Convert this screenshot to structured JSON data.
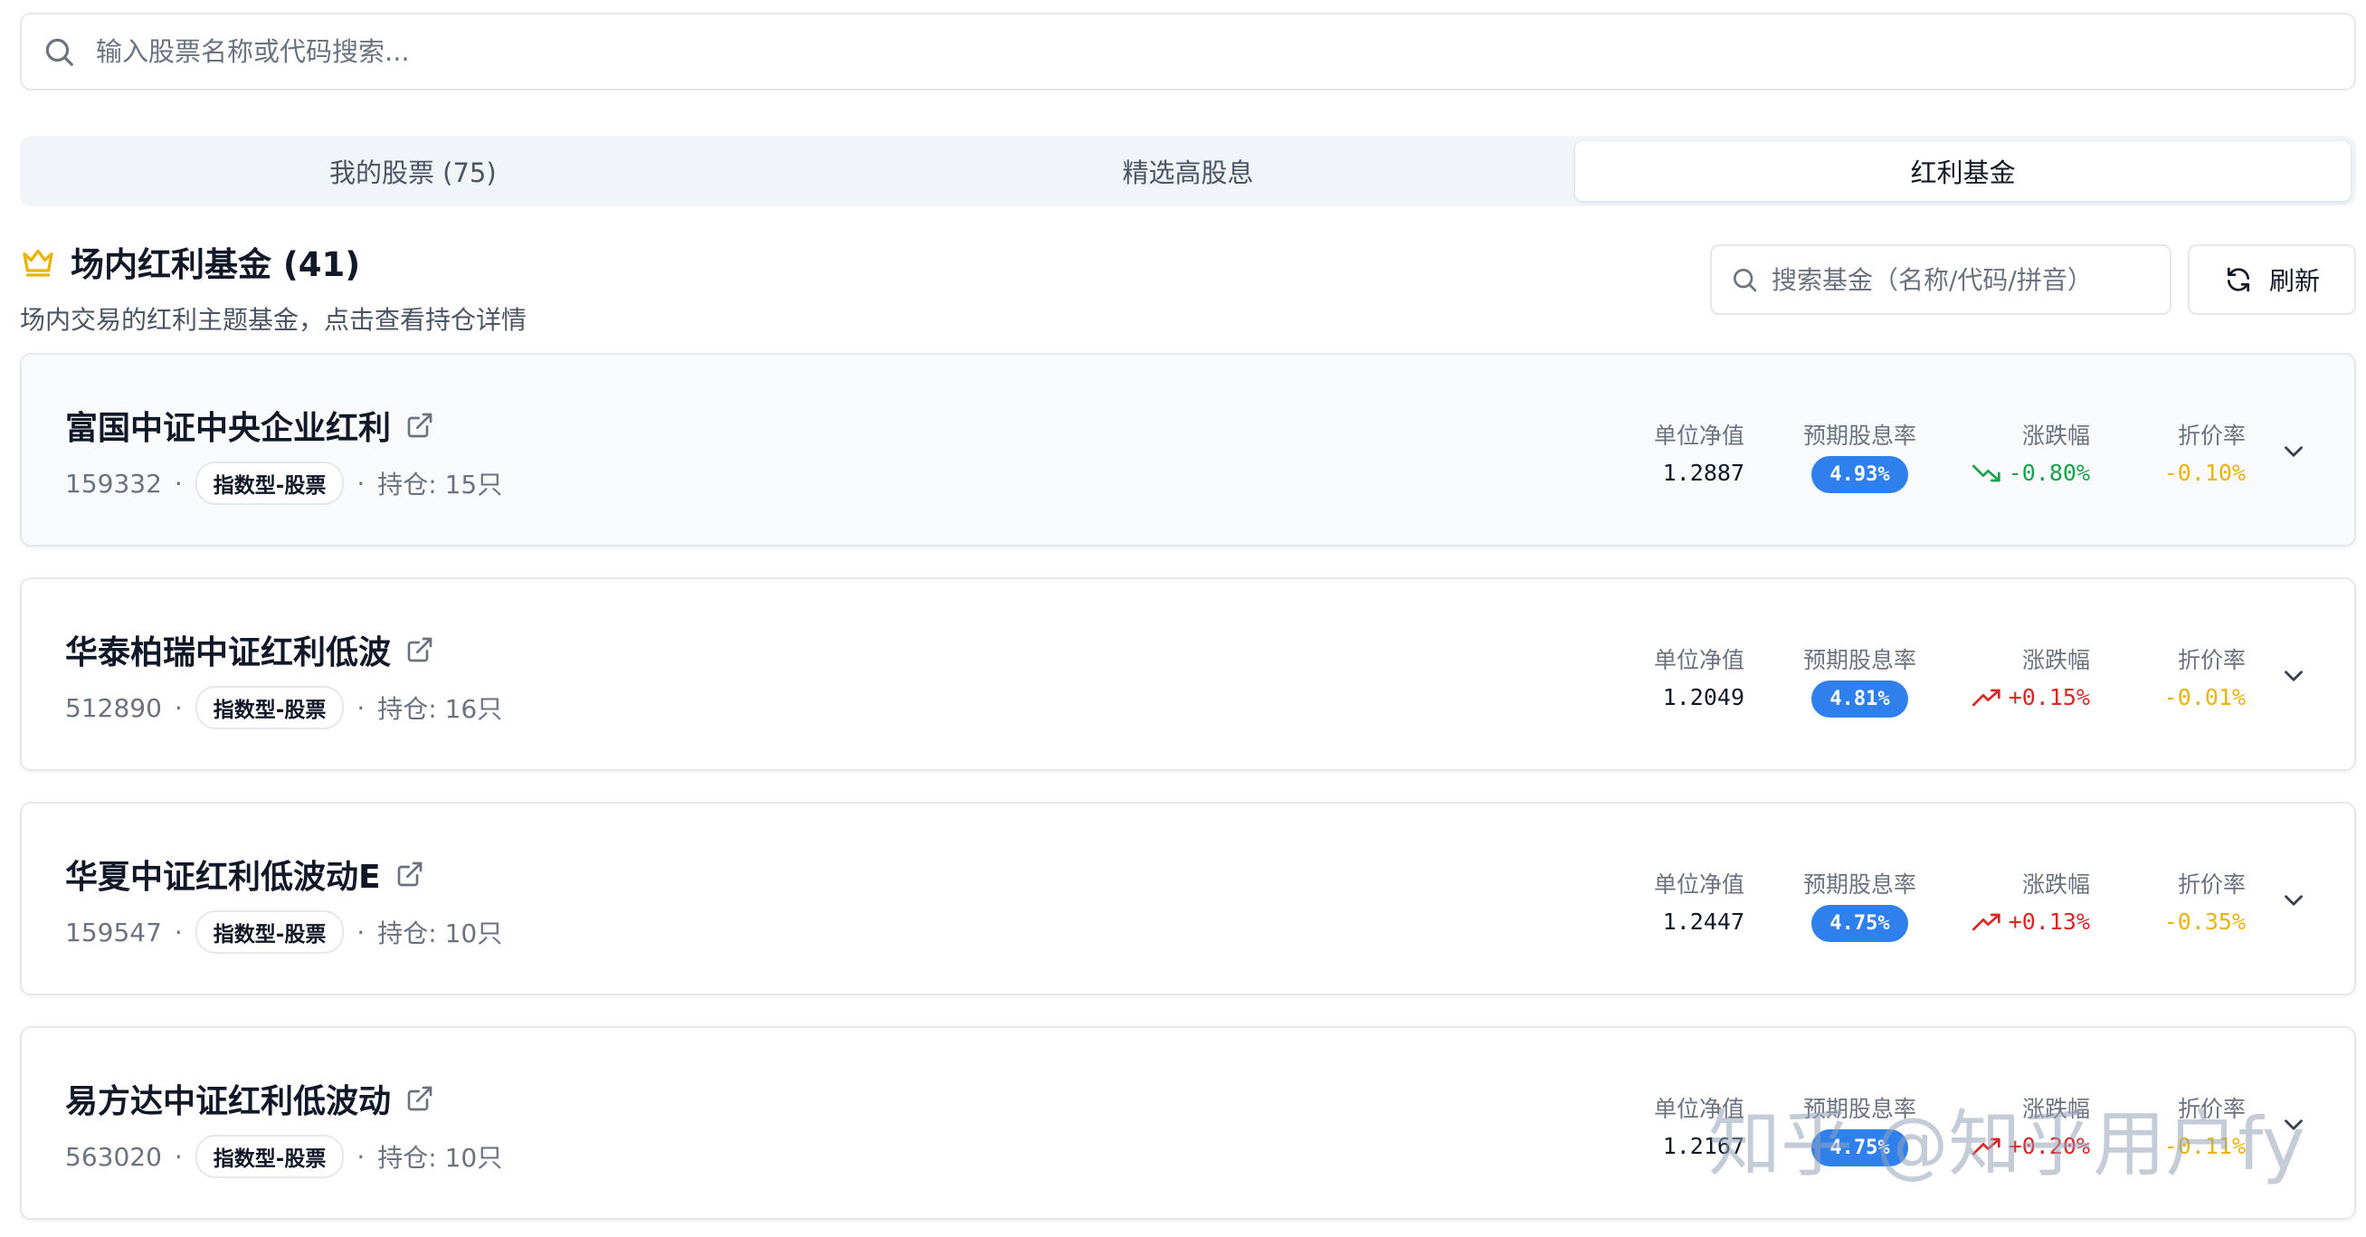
{
  "search": {
    "placeholder": "输入股票名称或代码搜索..."
  },
  "tabs": [
    {
      "label": "我的股票 (75)",
      "active": false
    },
    {
      "label": "精选高股息",
      "active": false
    },
    {
      "label": "红利基金",
      "active": true
    }
  ],
  "section": {
    "title": "场内红利基金 (41)",
    "subtitle": "场内交易的红利主题基金，点击查看持仓详情",
    "search_placeholder": "搜索基金（名称/代码/拼音）",
    "refresh_label": "刷新"
  },
  "metric_labels": {
    "nav": "单位净值",
    "yield": "预期股息率",
    "change": "涨跌幅",
    "discount": "折价率"
  },
  "funds": [
    {
      "name": "富国中证中央企业红利",
      "code": "159332",
      "type": "指数型-股票",
      "holdings": "持仓: 15只",
      "nav": "1.2887",
      "yield": "4.93%",
      "change": "-0.80%",
      "direction": "down",
      "discount": "-0.10%"
    },
    {
      "name": "华泰柏瑞中证红利低波",
      "code": "512890",
      "type": "指数型-股票",
      "holdings": "持仓: 16只",
      "nav": "1.2049",
      "yield": "4.81%",
      "change": "+0.15%",
      "direction": "up",
      "discount": "-0.01%"
    },
    {
      "name": "华夏中证红利低波动E",
      "code": "159547",
      "type": "指数型-股票",
      "holdings": "持仓: 10只",
      "nav": "1.2447",
      "yield": "4.75%",
      "change": "+0.13%",
      "direction": "up",
      "discount": "-0.35%"
    },
    {
      "name": "易方达中证红利低波动",
      "code": "563020",
      "type": "指数型-股票",
      "holdings": "持仓: 10只",
      "nav": "1.2167",
      "yield": "4.75%",
      "change": "+0.20%",
      "direction": "up",
      "discount": "-0.11%"
    }
  ],
  "colors": {
    "accent_blue": "#2f80ed",
    "up_red": "#dc2626",
    "down_green": "#16a34a",
    "discount_yellow": "#eab308",
    "crown_gold": "#eab308"
  },
  "watermark": "知乎 @知乎用户fy"
}
